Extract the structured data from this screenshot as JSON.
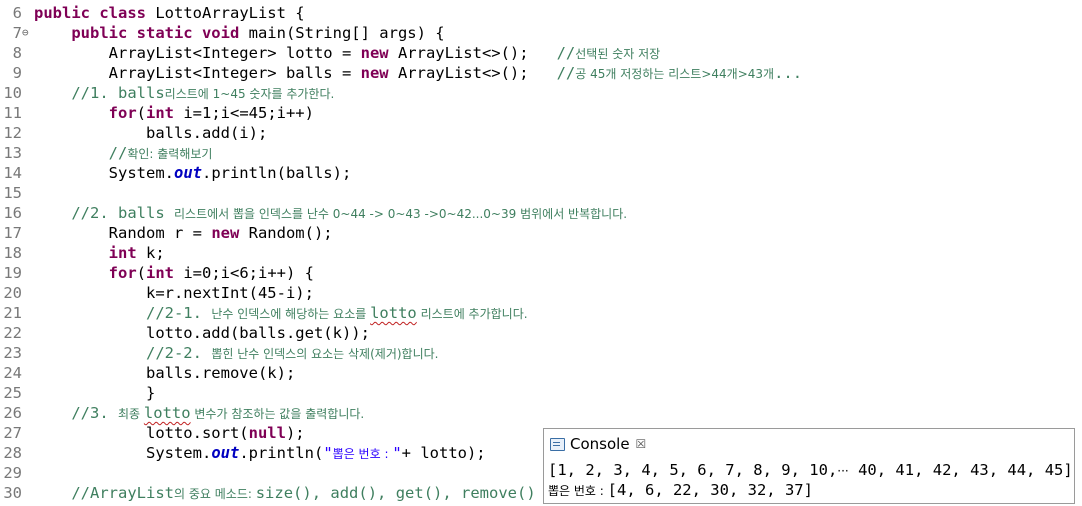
{
  "editor": {
    "lines": [
      {
        "n": "6",
        "fold": "",
        "segs": [
          {
            "t": "public class ",
            "c": "kw"
          },
          {
            "t": "LottoArrayList {",
            "c": ""
          }
        ]
      },
      {
        "n": "7",
        "fold": "⊖",
        "segs": [
          {
            "t": "    ",
            "c": ""
          },
          {
            "t": "public static void ",
            "c": "kw"
          },
          {
            "t": "main(String[] args) {",
            "c": ""
          }
        ]
      },
      {
        "n": "8",
        "fold": "",
        "segs": [
          {
            "t": "        ArrayList<Integer> lotto = ",
            "c": ""
          },
          {
            "t": "new ",
            "c": "kw"
          },
          {
            "t": "ArrayList<>();   ",
            "c": ""
          },
          {
            "t": "//",
            "c": "cm"
          },
          {
            "t": "선택된 숫자 저장",
            "c": "cm ko"
          }
        ]
      },
      {
        "n": "9",
        "fold": "",
        "segs": [
          {
            "t": "        ArrayList<Integer> balls = ",
            "c": ""
          },
          {
            "t": "new ",
            "c": "kw"
          },
          {
            "t": "ArrayList<>();   ",
            "c": ""
          },
          {
            "t": "//",
            "c": "cm"
          },
          {
            "t": "공 45개 저정하는 리스트>44개>43개",
            "c": "cm ko"
          },
          {
            "t": "...",
            "c": "cm"
          }
        ]
      },
      {
        "n": "10",
        "fold": "",
        "segs": [
          {
            "t": "    ",
            "c": ""
          },
          {
            "t": "//1. balls",
            "c": "cm"
          },
          {
            "t": "리스트에 1~45 숫자를 추가한다.",
            "c": "cm ko"
          }
        ]
      },
      {
        "n": "11",
        "fold": "",
        "segs": [
          {
            "t": "        ",
            "c": ""
          },
          {
            "t": "for",
            "c": "kw"
          },
          {
            "t": "(",
            "c": ""
          },
          {
            "t": "int ",
            "c": "kw"
          },
          {
            "t": "i=1;i<=45;i++)",
            "c": ""
          }
        ]
      },
      {
        "n": "12",
        "fold": "",
        "segs": [
          {
            "t": "            balls.add(i);",
            "c": ""
          }
        ]
      },
      {
        "n": "13",
        "fold": "",
        "segs": [
          {
            "t": "        ",
            "c": ""
          },
          {
            "t": "//",
            "c": "cm"
          },
          {
            "t": "확인: 출력해보기",
            "c": "cm ko"
          }
        ]
      },
      {
        "n": "14",
        "fold": "",
        "segs": [
          {
            "t": "        System.",
            "c": ""
          },
          {
            "t": "out",
            "c": "sf"
          },
          {
            "t": ".println(balls);",
            "c": ""
          }
        ]
      },
      {
        "n": "15",
        "fold": "",
        "segs": []
      },
      {
        "n": "16",
        "fold": "",
        "segs": [
          {
            "t": "    ",
            "c": ""
          },
          {
            "t": "//2. balls ",
            "c": "cm"
          },
          {
            "t": "리스트에서 뽑을 인덱스를 난수 0~44 -> 0~43 ->0~42...0~39 범위에서 반복합니다.",
            "c": "cm ko"
          }
        ]
      },
      {
        "n": "17",
        "fold": "",
        "segs": [
          {
            "t": "        Random r = ",
            "c": ""
          },
          {
            "t": "new ",
            "c": "kw"
          },
          {
            "t": "Random();",
            "c": ""
          }
        ]
      },
      {
        "n": "18",
        "fold": "",
        "segs": [
          {
            "t": "        ",
            "c": ""
          },
          {
            "t": "int ",
            "c": "kw"
          },
          {
            "t": "k;",
            "c": ""
          }
        ]
      },
      {
        "n": "19",
        "fold": "",
        "segs": [
          {
            "t": "        ",
            "c": ""
          },
          {
            "t": "for",
            "c": "kw"
          },
          {
            "t": "(",
            "c": ""
          },
          {
            "t": "int ",
            "c": "kw"
          },
          {
            "t": "i=0;i<6;i++) {",
            "c": ""
          }
        ]
      },
      {
        "n": "20",
        "fold": "",
        "segs": [
          {
            "t": "            k=r.nextInt(45-i);",
            "c": ""
          }
        ]
      },
      {
        "n": "21",
        "fold": "",
        "segs": [
          {
            "t": "            ",
            "c": ""
          },
          {
            "t": "//2-1. ",
            "c": "cm"
          },
          {
            "t": "난수 인덱스에 해당하는 요소를 ",
            "c": "cm ko"
          },
          {
            "t": "lotto",
            "c": "cm sq"
          },
          {
            "t": " 리스트에 추가합니다.",
            "c": "cm ko"
          }
        ]
      },
      {
        "n": "22",
        "fold": "",
        "segs": [
          {
            "t": "            lotto.add(balls.get(k));",
            "c": ""
          }
        ]
      },
      {
        "n": "23",
        "fold": "",
        "segs": [
          {
            "t": "            ",
            "c": ""
          },
          {
            "t": "//2-2. ",
            "c": "cm"
          },
          {
            "t": "뽑힌 난수 인덱스의 요소는 삭제(제거)합니다.",
            "c": "cm ko"
          }
        ]
      },
      {
        "n": "24",
        "fold": "",
        "segs": [
          {
            "t": "            balls.remove(k);",
            "c": ""
          }
        ]
      },
      {
        "n": "25",
        "fold": "",
        "segs": [
          {
            "t": "            }",
            "c": ""
          }
        ]
      },
      {
        "n": "26",
        "fold": "",
        "segs": [
          {
            "t": "    ",
            "c": ""
          },
          {
            "t": "//3. ",
            "c": "cm"
          },
          {
            "t": "최종 ",
            "c": "cm ko"
          },
          {
            "t": "lotto",
            "c": "cm sq"
          },
          {
            "t": " 변수가 참조하는 값을 출력합니다.",
            "c": "cm ko"
          }
        ]
      },
      {
        "n": "27",
        "fold": "",
        "segs": [
          {
            "t": "            lotto.sort(",
            "c": ""
          },
          {
            "t": "null",
            "c": "kw"
          },
          {
            "t": ");",
            "c": ""
          }
        ]
      },
      {
        "n": "28",
        "fold": "",
        "segs": [
          {
            "t": "            System.",
            "c": ""
          },
          {
            "t": "out",
            "c": "sf"
          },
          {
            "t": ".println(",
            "c": ""
          },
          {
            "t": "\"",
            "c": "st"
          },
          {
            "t": "뽑은 번호 : ",
            "c": "st ko"
          },
          {
            "t": "\"",
            "c": "st"
          },
          {
            "t": "+ lotto);",
            "c": ""
          }
        ]
      },
      {
        "n": "29",
        "fold": "",
        "segs": []
      },
      {
        "n": "30",
        "fold": "",
        "segs": [
          {
            "t": "    ",
            "c": ""
          },
          {
            "t": "//ArrayList",
            "c": "cm"
          },
          {
            "t": "의 중요 메소드: ",
            "c": "cm ko"
          },
          {
            "t": "size(), add(), get(), remove()",
            "c": "cm"
          }
        ]
      }
    ]
  },
  "console": {
    "title": "Console",
    "close_glyph": "☒",
    "output": [
      {
        "segs": [
          {
            "t": "[1, 2, 3, 4, 5, 6, 7, 8, 9, 10,",
            "c": ""
          },
          {
            "t": "···",
            "c": "ko"
          },
          {
            "t": " 40, 41, 42, 43, 44, 45]",
            "c": ""
          }
        ]
      },
      {
        "segs": [
          {
            "t": "뽑은 번호 : ",
            "c": "ko"
          },
          {
            "t": "[4, 6, 22, 30, 32, 37]",
            "c": ""
          }
        ]
      }
    ]
  }
}
